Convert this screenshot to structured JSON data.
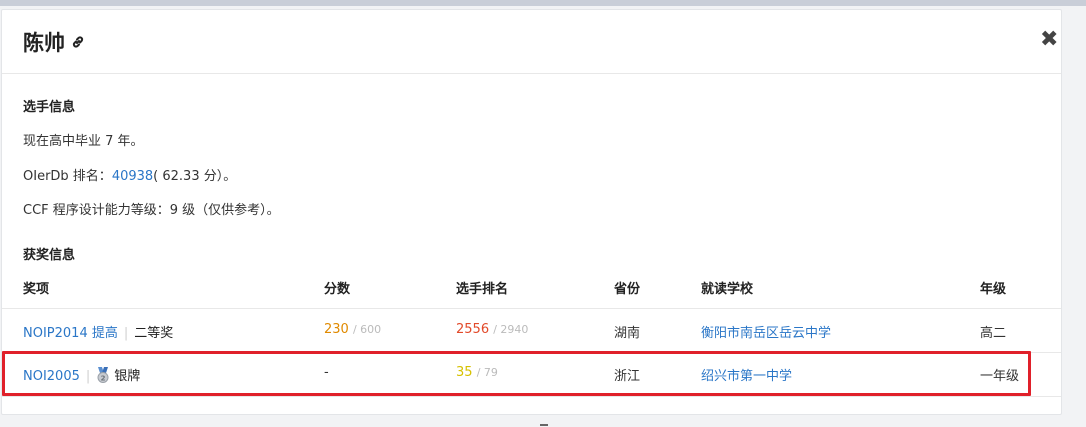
{
  "modal": {
    "title": "陈帅",
    "close_label": "✖"
  },
  "player_info": {
    "section_title": "选手信息",
    "graduation_text": "现在高中毕业 7 年。",
    "rank_prefix": "OIerDb 排名：",
    "rank_value": "40938",
    "rank_suffix": "( 62.33 分）。",
    "ccf_text": "CCF 程序设计能力等级：9 级（仅供参考）。"
  },
  "awards": {
    "section_title": "获奖信息",
    "headers": {
      "award": "奖项",
      "score": "分数",
      "rank": "选手排名",
      "province": "省份",
      "school": "就读学校",
      "grade": "年级"
    },
    "rows": [
      {
        "contest": "NOIP2014 提高",
        "award": "二等奖",
        "medal": false,
        "score": "230",
        "score_total": "/ 600",
        "rank": "2556",
        "rank_total": "/ 2940",
        "province": "湖南",
        "school": "衡阳市南岳区岳云中学",
        "grade": "高二"
      },
      {
        "contest": "NOI2005",
        "award": "银牌",
        "medal": true,
        "medal_icon": "silver-medal-icon",
        "score": "-",
        "score_total": "",
        "rank": "35",
        "rank_total": "/ 79",
        "province": "浙江",
        "school": "绍兴市第一中学",
        "grade": "一年级"
      }
    ]
  },
  "colors": {
    "link": "#2a76c7",
    "highlight_border": "#e0202a",
    "score_orange": "#e08a00",
    "rank_red": "#e24a2a",
    "score_yellow": "#d6c100"
  }
}
